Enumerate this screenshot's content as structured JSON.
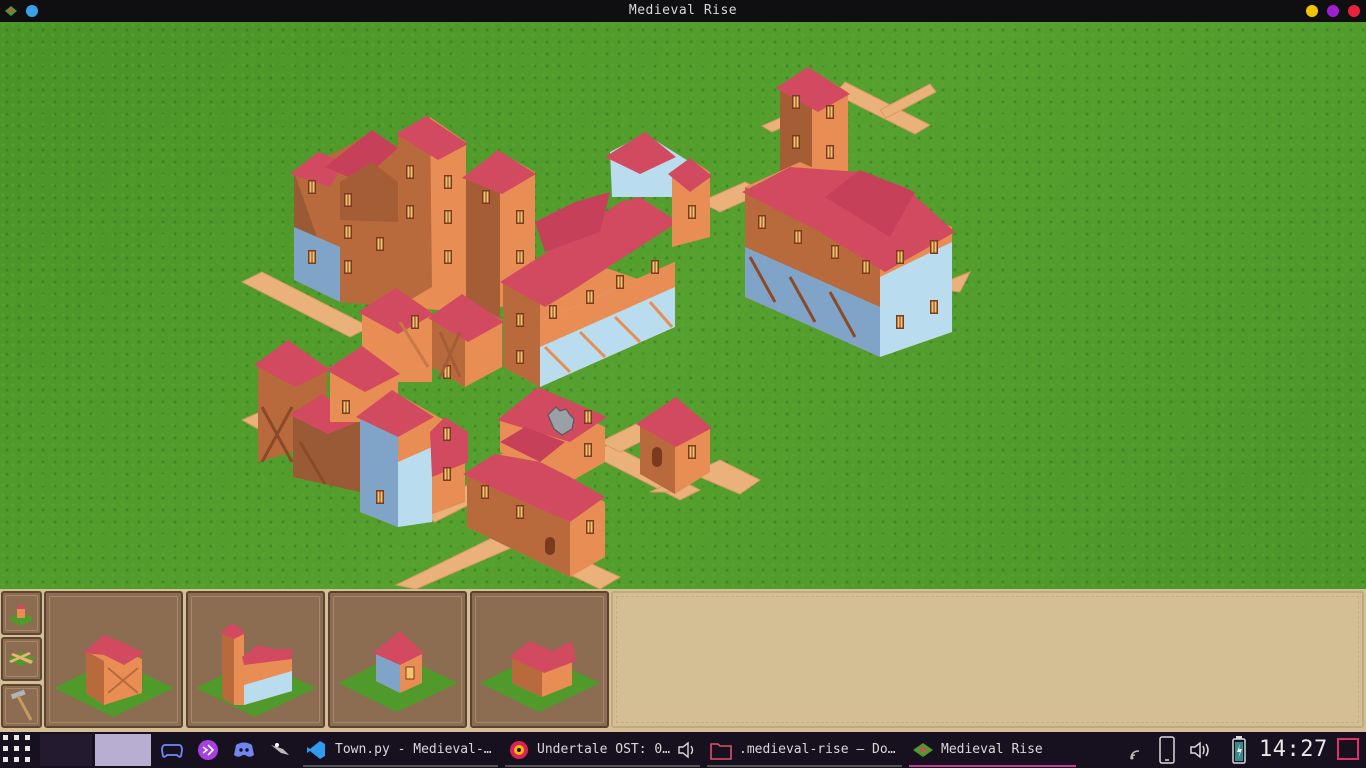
{
  "window": {
    "title": "Medieval Rise",
    "app_icon": "medieval-rise-icon",
    "buttons": [
      {
        "name": "minimize",
        "color": "#f5c400"
      },
      {
        "name": "maximize",
        "color": "#a020d0"
      },
      {
        "name": "close",
        "color": "#e8223a"
      }
    ],
    "pin_color": "#3aa0e8"
  },
  "game": {
    "grass_color": "#4f9a2a",
    "road_color": "#eab27a",
    "roof_color": "#d24a5f",
    "wall_color": "#e88d54",
    "timber_color": "#9a5a35",
    "plaster_color": "#b9dcef",
    "cursor": "hand-pointer-icon"
  },
  "toolbar": {
    "tools": [
      {
        "name": "build-house-tool",
        "icon": "house-tile-icon"
      },
      {
        "name": "build-road-tool",
        "icon": "road-cross-icon"
      },
      {
        "name": "demolish-tool",
        "icon": "hammer-icon"
      }
    ],
    "cards": [
      {
        "name": "card-timber-house",
        "icon": "timber-house-icon"
      },
      {
        "name": "card-tall-row-house",
        "icon": "tall-row-house-icon"
      },
      {
        "name": "card-small-cottage",
        "icon": "small-cottage-icon"
      },
      {
        "name": "card-twin-house",
        "icon": "twin-house-icon"
      }
    ]
  },
  "taskbar": {
    "launcher_icon": "app-grid-icon",
    "apps": [
      {
        "name": "games-icon",
        "color": "#6b8cff"
      },
      {
        "name": "visual-studio-icon",
        "color": "#a640e0"
      },
      {
        "name": "discord-icon",
        "color": "#6f86f0"
      },
      {
        "name": "inkscape-icon",
        "color": "#bbbbbb"
      }
    ],
    "windows": [
      {
        "label": "Town.py - Medieval-…",
        "icon": "vscode-icon",
        "underline": "#555"
      },
      {
        "label": "Undertale OST: 0…",
        "icon": "music-player-icon",
        "underline": "#555"
      },
      {
        "label": ".medieval-rise — Do…",
        "icon": "folder-icon",
        "underline": "#555"
      },
      {
        "label": "Medieval Rise",
        "icon": "medieval-rise-icon",
        "underline": "#c04090"
      }
    ],
    "tray": [
      "network-icon",
      "phone-icon",
      "volume-icon",
      "battery-icon"
    ],
    "clock": "14:27",
    "accent": "#e0306a"
  }
}
